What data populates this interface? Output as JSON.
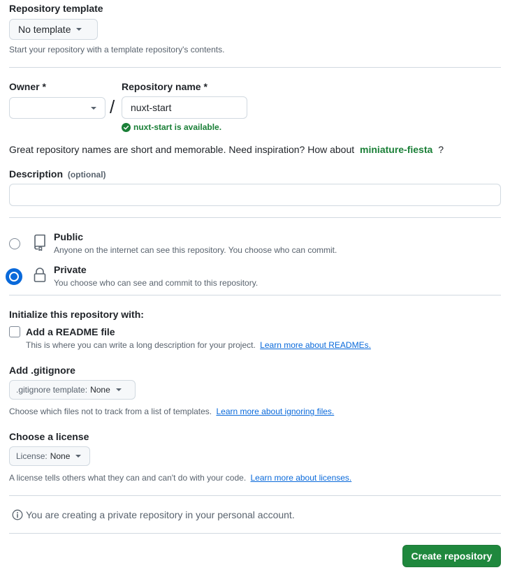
{
  "template": {
    "label": "Repository template",
    "selected": "No template",
    "note": "Start your repository with a template repository's contents."
  },
  "owner": {
    "label": "Owner *",
    "value": ""
  },
  "separator": "/",
  "repo": {
    "label": "Repository name *",
    "value": "nuxt-start",
    "availability": "nuxt-start is available."
  },
  "inspiration": {
    "text": "Great repository names are short and memorable. Need inspiration? How about",
    "suggestion": "miniature-fiesta",
    "end": "?"
  },
  "description": {
    "label": "Description",
    "optional": "(optional)",
    "value": ""
  },
  "visibility": {
    "public": {
      "title": "Public",
      "desc": "Anyone on the internet can see this repository. You choose who can commit.",
      "selected": false
    },
    "private": {
      "title": "Private",
      "desc": "You choose who can see and commit to this repository.",
      "selected": true
    }
  },
  "init": {
    "heading": "Initialize this repository with:",
    "readme_label": "Add a README file",
    "readme_desc": "This is where you can write a long description for your project.",
    "readme_link": "Learn more about READMEs.",
    "readme_checked": false
  },
  "gitignore": {
    "heading": "Add .gitignore",
    "prefix": ".gitignore template:",
    "value": "None",
    "desc": "Choose which files not to track from a list of templates.",
    "link": "Learn more about ignoring files."
  },
  "license": {
    "heading": "Choose a license",
    "prefix": "License:",
    "value": "None",
    "desc": "A license tells others what they can and can't do with your code.",
    "link": "Learn more about licenses."
  },
  "info": "You are creating a private repository in your personal account.",
  "submit_label": "Create repository",
  "colors": {
    "accent": "#0969da",
    "success": "#1a7f37",
    "button_green": "#1f883d"
  },
  "icons": [
    "chevron-down-icon",
    "check-circle-icon",
    "repo-icon",
    "lock-icon",
    "info-icon"
  ]
}
